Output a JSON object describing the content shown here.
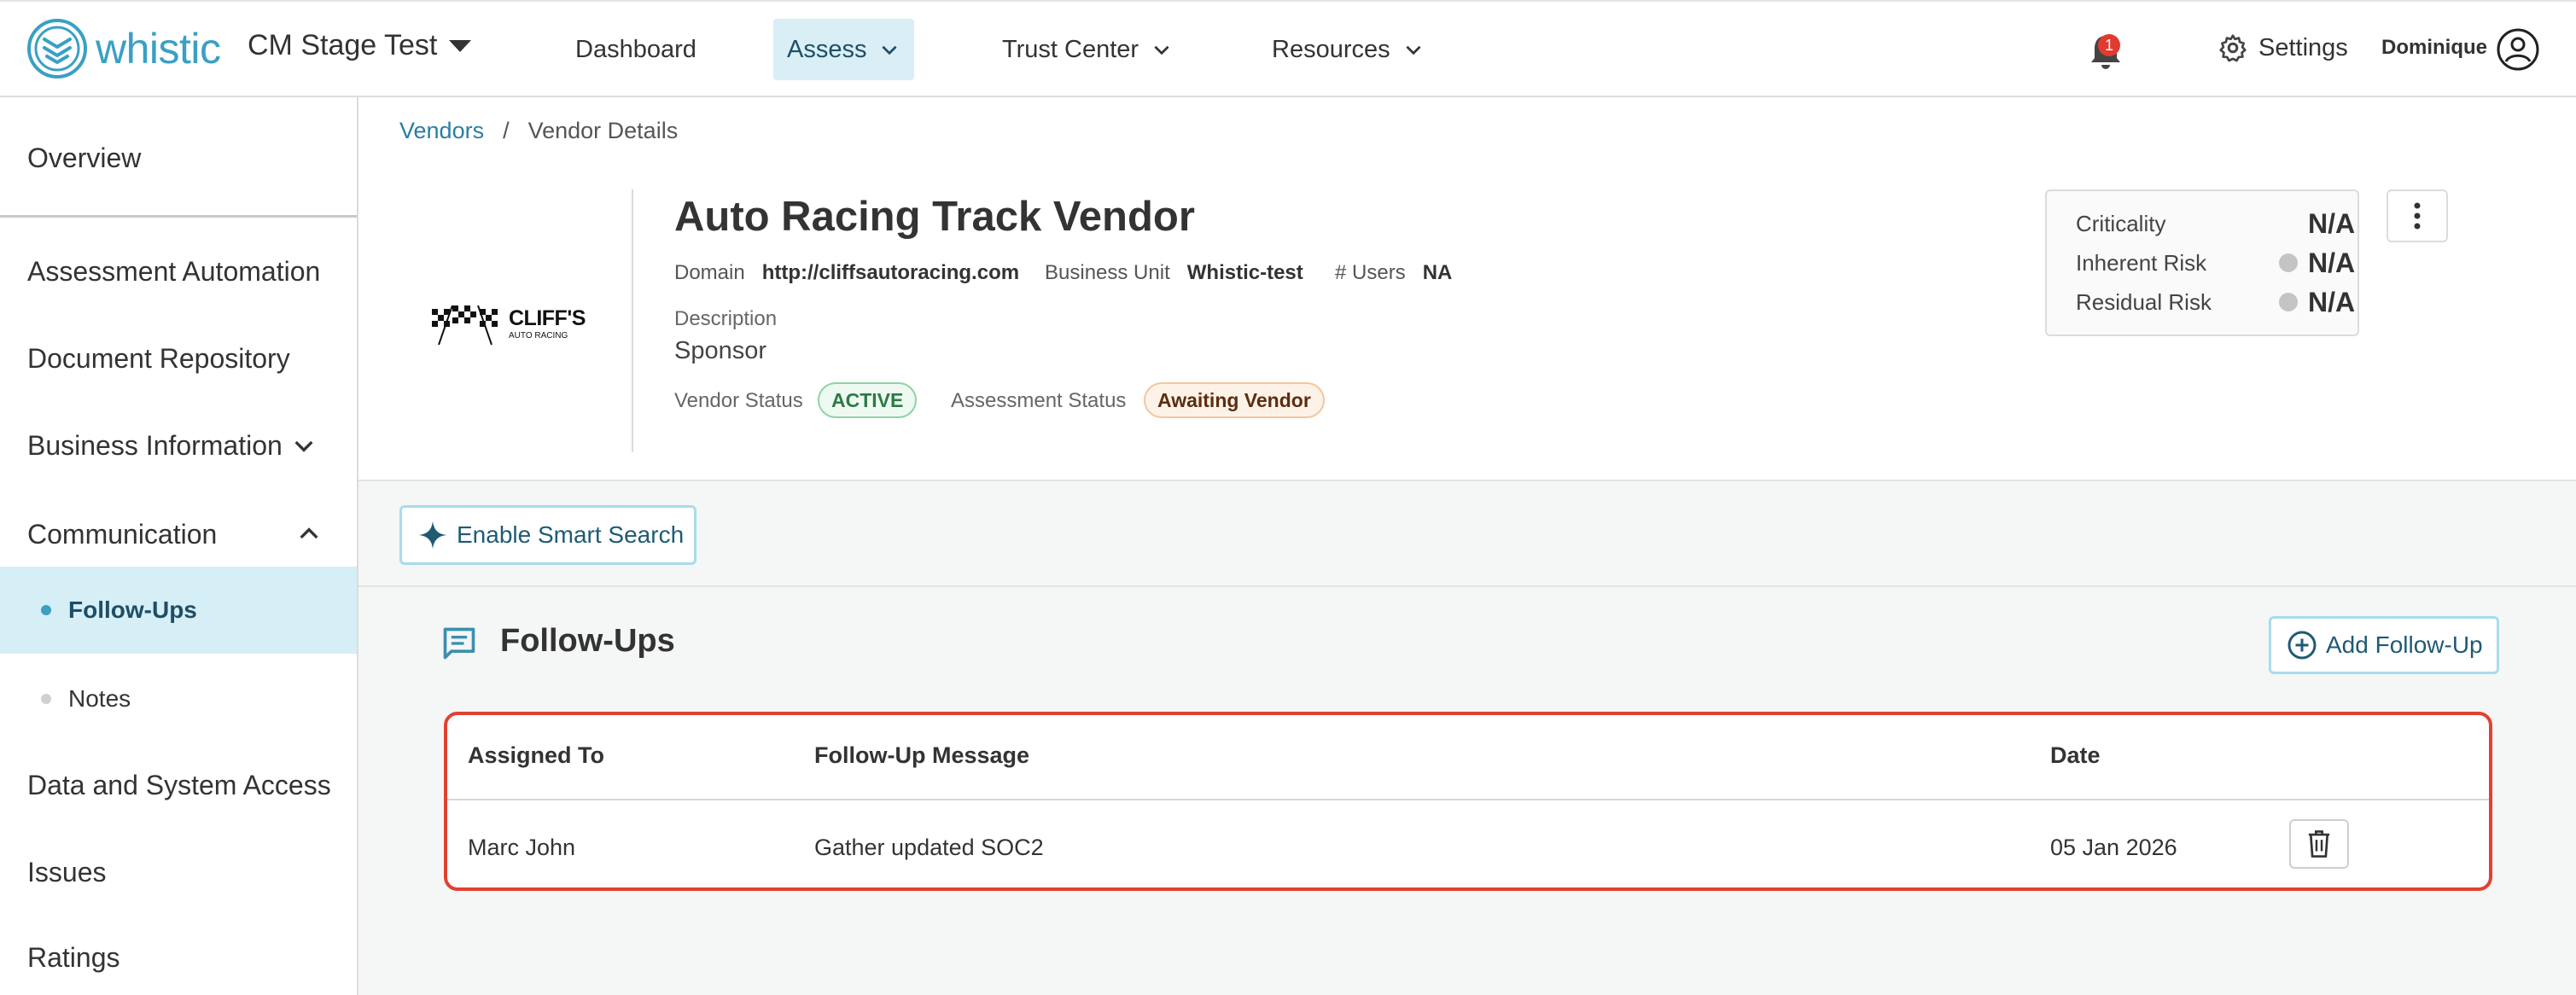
{
  "brand": {
    "name": "whistic",
    "accent": "#3aa0c4"
  },
  "org": {
    "name": "CM Stage Test"
  },
  "nav": {
    "dashboard": "Dashboard",
    "assess": "Assess",
    "trust_center": "Trust Center",
    "resources": "Resources",
    "notifications_count": "1",
    "settings": "Settings",
    "user": "Dominique"
  },
  "sidebar": {
    "items": [
      {
        "label": "Overview"
      },
      {
        "label": "Assessment Automation"
      },
      {
        "label": "Document Repository"
      },
      {
        "label": "Business Information"
      },
      {
        "label": "Communication"
      },
      {
        "label": "Data and System Access"
      },
      {
        "label": "Issues"
      },
      {
        "label": "Ratings"
      }
    ],
    "sub_items": [
      {
        "label": "Follow-Ups",
        "active": true
      },
      {
        "label": "Notes",
        "active": false
      }
    ]
  },
  "breadcrumb": {
    "root": "Vendors",
    "separator": "/",
    "current": "Vendor Details"
  },
  "vendor": {
    "logo_text": "CLIFF'S",
    "logo_subtext": "AUTO RACING",
    "name": "Auto Racing Track Vendor",
    "domain_label": "Domain",
    "domain_value": "http://cliffsautoracing.com",
    "business_unit_label": "Business Unit",
    "business_unit_value": "Whistic-test",
    "users_label": "# Users",
    "users_value": "NA",
    "description_label": "Description",
    "description_value": "Sponsor",
    "vendor_status_label": "Vendor Status",
    "vendor_status_value": "ACTIVE",
    "assessment_status_label": "Assessment Status",
    "assessment_status_value": "Awaiting Vendor"
  },
  "risk": {
    "criticality_label": "Criticality",
    "criticality_value": "N/A",
    "inherent_label": "Inherent Risk",
    "inherent_value": "N/A",
    "residual_label": "Residual Risk",
    "residual_value": "N/A"
  },
  "smart_search": {
    "label": "Enable Smart Search"
  },
  "followups": {
    "title": "Follow-Ups",
    "add_label": "Add Follow-Up",
    "columns": {
      "assigned": "Assigned To",
      "message": "Follow-Up Message",
      "date": "Date"
    },
    "rows": [
      {
        "assigned": "Marc John",
        "message": "Gather updated SOC2",
        "date": "05 Jan 2026"
      }
    ]
  }
}
